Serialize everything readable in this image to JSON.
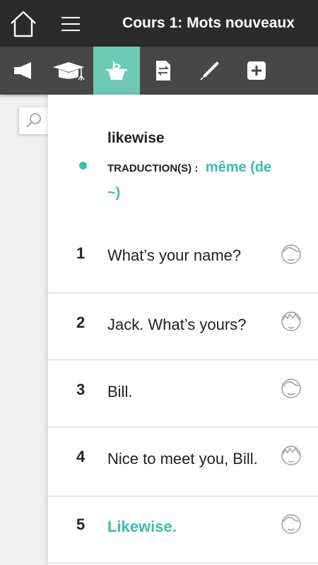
{
  "header": {
    "title": "Cours 1: Mots nouveaux"
  },
  "toolbar": {
    "items": [
      {
        "name": "audio",
        "icon": "megaphone-icon",
        "active": false
      },
      {
        "name": "learn",
        "icon": "graduation-cap-icon",
        "active": false
      },
      {
        "name": "vocabulary",
        "icon": "vocabulary-box-icon",
        "active": true
      },
      {
        "name": "translation",
        "icon": "translate-document-icon",
        "active": false
      },
      {
        "name": "write",
        "icon": "pen-icon",
        "active": false
      },
      {
        "name": "more",
        "icon": "plus-square-icon",
        "active": false
      }
    ],
    "accent_color": "#6ec9b2"
  },
  "search": {
    "icon": "search-icon"
  },
  "vocab": {
    "word": "likewise",
    "translation_label": "TRADUCTION(S) :",
    "translation_value": "même (de ~)"
  },
  "dialogue": [
    {
      "number": "1",
      "text": "What’s your name?",
      "speaker_icon": "person-a-face-icon",
      "highlight": false
    },
    {
      "number": "2",
      "text": "Jack. What’s yours?",
      "speaker_icon": "person-b-face-icon",
      "highlight": false
    },
    {
      "number": "3",
      "text": "Bill.",
      "speaker_icon": "person-a-face-icon",
      "highlight": false
    },
    {
      "number": "4",
      "text": "Nice to meet you, Bill.",
      "speaker_icon": "person-b-face-icon",
      "highlight": false
    },
    {
      "number": "5",
      "text": "Likewise.",
      "speaker_icon": "person-a-face-icon",
      "highlight": true
    }
  ],
  "colors": {
    "header_bg": "#2b2b2b",
    "toolbar_bg": "#474747",
    "highlight": "#3dbfa9"
  }
}
